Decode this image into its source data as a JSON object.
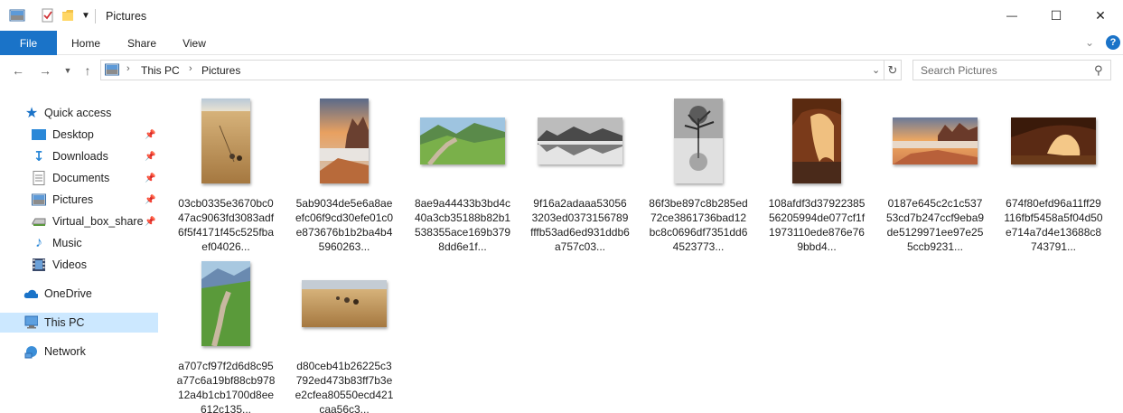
{
  "window": {
    "title": "Pictures",
    "minimize_glyph": "—",
    "maximize_glyph": "☐",
    "close_glyph": "✕"
  },
  "ribbon": {
    "tabs": [
      "File",
      "Home",
      "Share",
      "View"
    ],
    "help_glyph": "?"
  },
  "navigation": {
    "path": [
      "This PC",
      "Pictures"
    ],
    "search_placeholder": "Search Pictures"
  },
  "sidebar": {
    "quick_access": "Quick access",
    "pinned": [
      {
        "label": "Desktop",
        "icon": "desktop-icon"
      },
      {
        "label": "Downloads",
        "icon": "downloads-icon"
      },
      {
        "label": "Documents",
        "icon": "documents-icon"
      },
      {
        "label": "Pictures",
        "icon": "pictures-icon"
      },
      {
        "label": "Virtual_box_share",
        "icon": "drive-icon"
      }
    ],
    "other": [
      {
        "label": "Music",
        "icon": "music-icon"
      },
      {
        "label": "Videos",
        "icon": "videos-icon"
      }
    ],
    "onedrive": "OneDrive",
    "this_pc": "This PC",
    "network": "Network"
  },
  "files": [
    {
      "name": "03cb0335e3670bc047ac9063fd3083adf6f5f4171f45c525fbaef04026...",
      "scene": "field"
    },
    {
      "name": "5ab9034de5e6a8aeefc06f9cd30efe01c0e873676b1b2ba4b45960263...",
      "scene": "sea-rocks"
    },
    {
      "name": "8ae9a44433b3bd4c40a3cb35188b82b1538355ace169b3798dd6e1f...",
      "scene": "mountain-path"
    },
    {
      "name": "9f16a2adaaa530563203ed0373156789fffb53ad6ed931ddb6a757c03...",
      "scene": "bw-lake"
    },
    {
      "name": "86f3be897c8b285ed72ce3861736bad12bc8c0696df7351dd64523773...",
      "scene": "bw-tree"
    },
    {
      "name": "108afdf3d3792238556205994de077cf1f1973110ede876e769bbd4...",
      "scene": "sea-cave"
    },
    {
      "name": "0187e645c2c1c53753cd7b247ccf9eba9de5129971ee97e255ccb9231...",
      "scene": "sunset-coast"
    },
    {
      "name": "674f80efd96a11ff29116fbf5458a5f04d50e714a7d4e13688c8743791...",
      "scene": "sea-cave"
    },
    {
      "name": "a707cf97f2d6d8c95a77c6a19bf88cb97812a4b1cb1700d8ee612c135...",
      "scene": "mountain-path"
    },
    {
      "name": "d80ceb41b26225c3792ed473b83ff7b3ee2cfea80550ecd421caa56c3...",
      "scene": "field"
    }
  ]
}
